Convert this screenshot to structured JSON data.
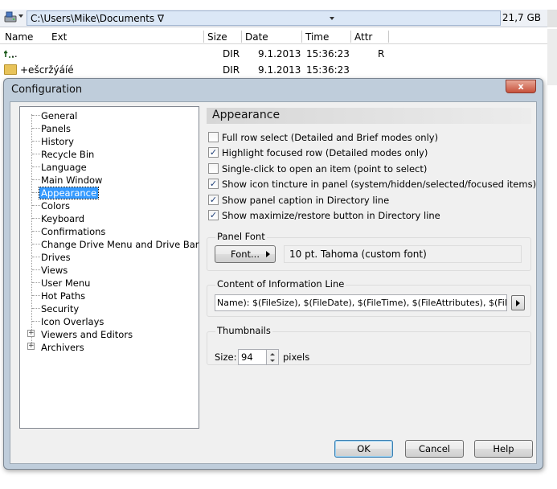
{
  "filemanager": {
    "path": "C:\\Users\\Mike\\Documents",
    "filter_symbol": "∇",
    "free_space": "21,7 GB",
    "columns": [
      "Name",
      "Ext",
      "Size",
      "Date",
      "Time",
      "Attr"
    ],
    "rows": [
      {
        "name": "..",
        "size": "DIR",
        "date": "9.1.2013",
        "time": "15:36:23",
        "attr": "R"
      },
      {
        "name": "+ešcržýáíé",
        "size": "DIR",
        "date": "9.1.2013",
        "time": "15:36:23",
        "attr": ""
      }
    ]
  },
  "dialog": {
    "title": "Configuration",
    "close_label": "x",
    "tree": [
      {
        "label": "General",
        "expandable": false
      },
      {
        "label": "Panels",
        "expandable": false
      },
      {
        "label": "History",
        "expandable": false
      },
      {
        "label": "Recycle Bin",
        "expandable": false
      },
      {
        "label": "Language",
        "expandable": false
      },
      {
        "label": "Main Window",
        "expandable": false
      },
      {
        "label": "Appearance",
        "expandable": false,
        "selected": true
      },
      {
        "label": "Colors",
        "expandable": false
      },
      {
        "label": "Keyboard",
        "expandable": false
      },
      {
        "label": "Confirmations",
        "expandable": false
      },
      {
        "label": "Change Drive Menu and Drive Bar",
        "expandable": false
      },
      {
        "label": "Drives",
        "expandable": false
      },
      {
        "label": "Views",
        "expandable": false
      },
      {
        "label": "User Menu",
        "expandable": false
      },
      {
        "label": "Hot Paths",
        "expandable": false
      },
      {
        "label": "Security",
        "expandable": false
      },
      {
        "label": "Icon Overlays",
        "expandable": false
      },
      {
        "label": "Viewers and Editors",
        "expandable": true
      },
      {
        "label": "Archivers",
        "expandable": true
      }
    ],
    "page_title": "Appearance",
    "checkboxes": [
      {
        "label": "Full row select (Detailed and Brief modes only)",
        "checked": false
      },
      {
        "label": "Highlight focused row (Detailed modes only)",
        "checked": true
      },
      {
        "label": "Single-click to open an item (point to select)",
        "checked": false
      },
      {
        "label": "Show icon tincture in panel (system/hidden/selected/focused items)",
        "checked": true
      },
      {
        "label": "Show panel caption in Directory line",
        "checked": true
      },
      {
        "label": "Show maximize/restore button in Directory line",
        "checked": true
      }
    ],
    "panel_font": {
      "group_label": "Panel Font",
      "button_label": "Font...",
      "value": "10 pt. Tahoma (custom font)"
    },
    "info_line": {
      "group_label": "Content of Information Line",
      "value": "Name): $(FileSize), $(FileDate), $(FileTime), $(FileAttributes), $(FileDOSName)"
    },
    "thumbnails": {
      "group_label": "Thumbnails",
      "size_label": "Size:",
      "size_value": "94",
      "unit_label": "pixels"
    },
    "buttons": {
      "ok": "OK",
      "cancel": "Cancel",
      "help": "Help"
    },
    "colors": {
      "selection": "#3399ff",
      "dialog_frame": "#bfcddb"
    }
  }
}
